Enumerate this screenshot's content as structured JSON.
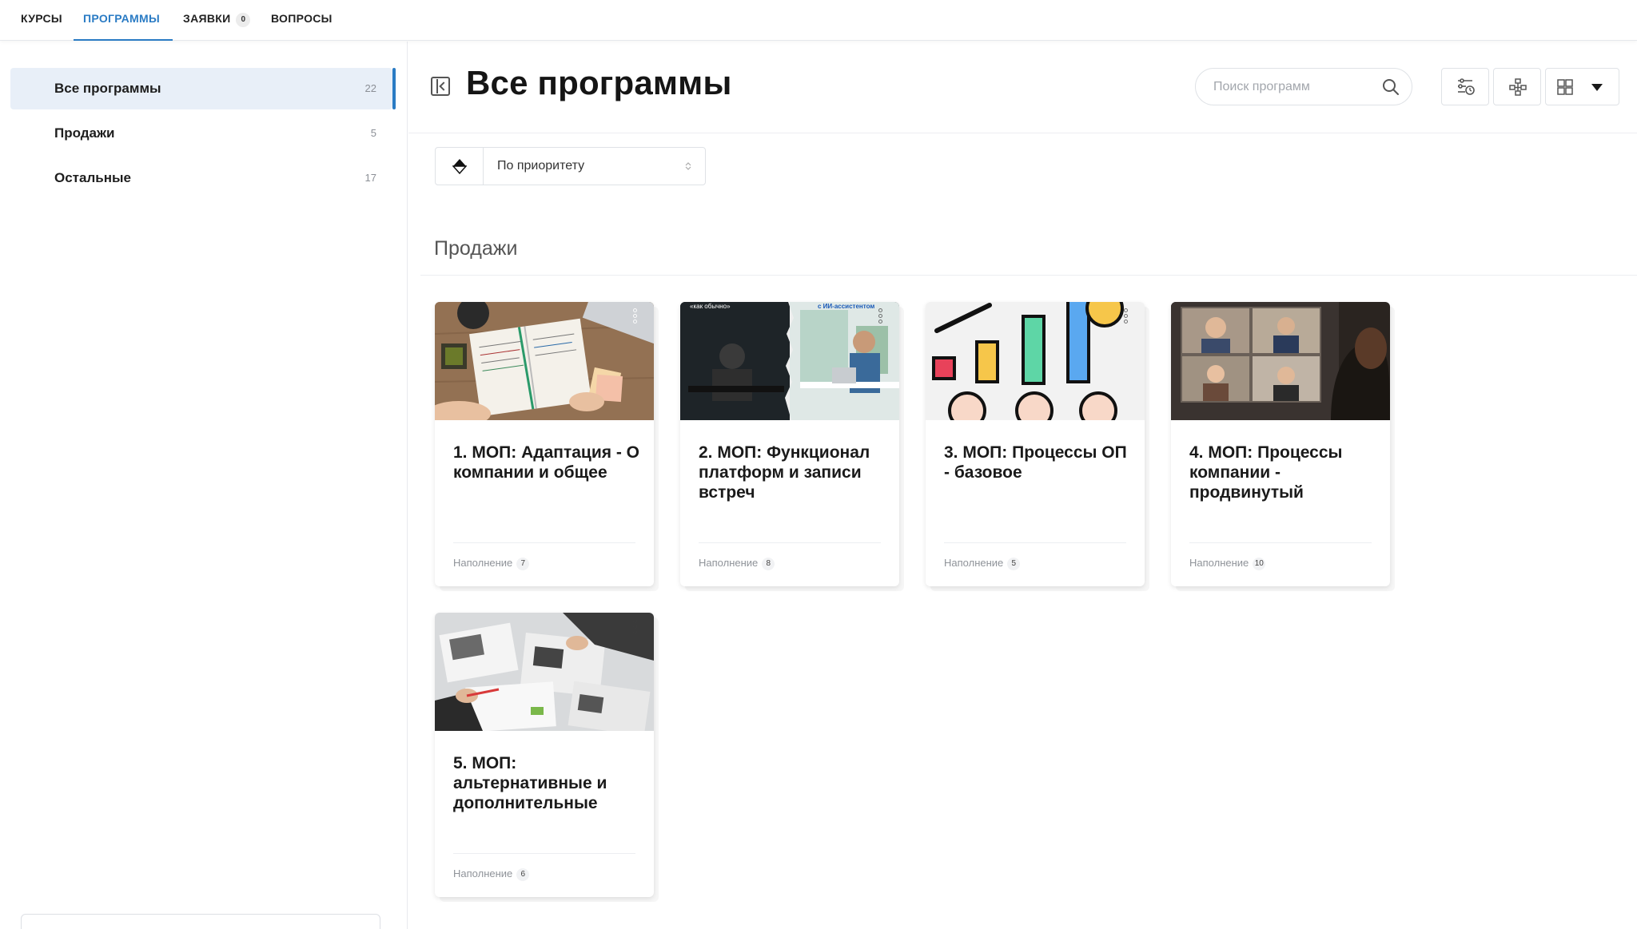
{
  "topnav": {
    "tabs": [
      {
        "label": "КУРСЫ"
      },
      {
        "label": "ПРОГРАММЫ",
        "active": true
      },
      {
        "label": "ЗАЯВКИ",
        "badge": "0"
      },
      {
        "label": "ВОПРОСЫ"
      }
    ]
  },
  "sidebar": {
    "items": [
      {
        "label": "Все программы",
        "count": "22",
        "active": true
      },
      {
        "label": "Продажи",
        "count": "5"
      },
      {
        "label": "Остальные",
        "count": "17"
      }
    ]
  },
  "header": {
    "title": "Все программы",
    "search_placeholder": "Поиск программ",
    "collapse_icon": "collapse-sidebar-icon",
    "toolbar_icons": [
      "filter-settings-icon",
      "hierarchy-icon",
      "grid-view-icon",
      "chevron-down-icon"
    ]
  },
  "sort": {
    "direction_icon": "sort-direction-icon",
    "selected": "По приоритету"
  },
  "section": {
    "title": "Продажи"
  },
  "cards": [
    {
      "title": "1. МОП: Адаптация - О компании и общее",
      "fill_label": "Наполнение",
      "fill_count": "7"
    },
    {
      "title": "2. МОП: Функционал платформ и записи встреч",
      "fill_label": "Наполнение",
      "fill_count": "8",
      "image_text_left": "«как обычно»",
      "image_text_right": "с ИИ-ассистентом"
    },
    {
      "title": "3. МОП: Процессы ОП - базовое",
      "fill_label": "Наполнение",
      "fill_count": "5"
    },
    {
      "title": "4. МОП: Процессы компании - продвинутый",
      "fill_label": "Наполнение",
      "fill_count": "10"
    },
    {
      "title": "5. МОП: альтернативные и дополнительные",
      "fill_label": "Наполнение",
      "fill_count": "6"
    }
  ],
  "colors": {
    "accent": "#2a7bc4",
    "active_bg": "#e8eff8"
  }
}
